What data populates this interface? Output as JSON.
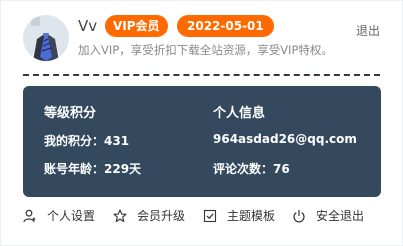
{
  "user": {
    "name": "Vv",
    "vip_badge": "VIP会员",
    "vip_expiry": "2022-05-01",
    "logout_label": "退出",
    "tagline": "加入VIP，享受折扣下载全站资源，享受VIP特权。"
  },
  "stats": {
    "level_title": "等级积分",
    "points": "我的积分：431",
    "account_age": "账号年龄：229天",
    "info_title": "个人信息",
    "email": "964asdad26@qq.com",
    "comments": "评论次数：76"
  },
  "nav": {
    "items": [
      {
        "label": "个人设置",
        "icon": "user-icon"
      },
      {
        "label": "会员升级",
        "icon": "star-icon"
      },
      {
        "label": "主题模板",
        "icon": "checkbox-icon"
      },
      {
        "label": "安全退出",
        "icon": "power-icon"
      }
    ]
  },
  "colors": {
    "badge": "#ff6a00",
    "panel": "#34495e"
  }
}
